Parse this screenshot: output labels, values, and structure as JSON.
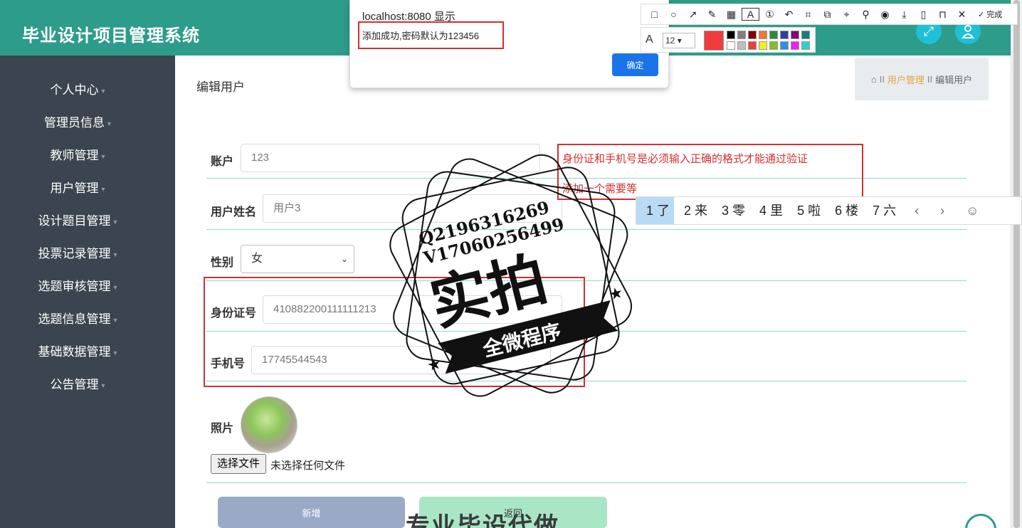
{
  "header": {
    "title": "毕业设计项目管理系统",
    "fullscreen_icon": "expand-icon",
    "user_icon": "user-icon"
  },
  "sidebar": {
    "items": [
      {
        "label": "个人中心"
      },
      {
        "label": "管理员信息"
      },
      {
        "label": "教师管理"
      },
      {
        "label": "用户管理"
      },
      {
        "label": "设计题目管理"
      },
      {
        "label": "投票记录管理"
      },
      {
        "label": "选题审核管理"
      },
      {
        "label": "选题信息管理"
      },
      {
        "label": "基础数据管理"
      },
      {
        "label": "公告管理"
      }
    ]
  },
  "main": {
    "page_title": "编辑用户",
    "breadcrumb": {
      "current_section": "用户管理",
      "page": "编辑用户",
      "separator": "II"
    },
    "form": {
      "account_label": "账户",
      "account_value": "123",
      "name_label": "用户姓名",
      "name_value": "用户3",
      "gender_label": "性别",
      "gender_value": "女",
      "id_label": "身份证号",
      "id_value": "410882200111111213",
      "phone_label": "手机号",
      "phone_value": "17745544543",
      "photo_label": "照片",
      "file_button": "选择文件",
      "file_status": "未选择任何文件"
    },
    "buttons": {
      "add": "新增",
      "back": "返回"
    }
  },
  "alert": {
    "title": "localhost:8080 显示",
    "message": "添加成功,密码默认为123456",
    "ok": "确定"
  },
  "annotations": {
    "note1": "身份证和手机号是必须输入正确的格式才能通过验证",
    "note2": "添加一个需要等"
  },
  "screenshot_tool": {
    "font_size": "12",
    "done": "完成",
    "current_color": "#f03c3c"
  },
  "ime": {
    "candidates": [
      "1 了",
      "2 来",
      "3 零",
      "4 里",
      "5 啦",
      "6 楼",
      "7 六"
    ]
  },
  "watermark": {
    "contact1": "Q2196316269",
    "contact2": "V17060256499",
    "big": "实拍",
    "ribbon": "全微程序",
    "bottom": "专业毕设代做"
  }
}
